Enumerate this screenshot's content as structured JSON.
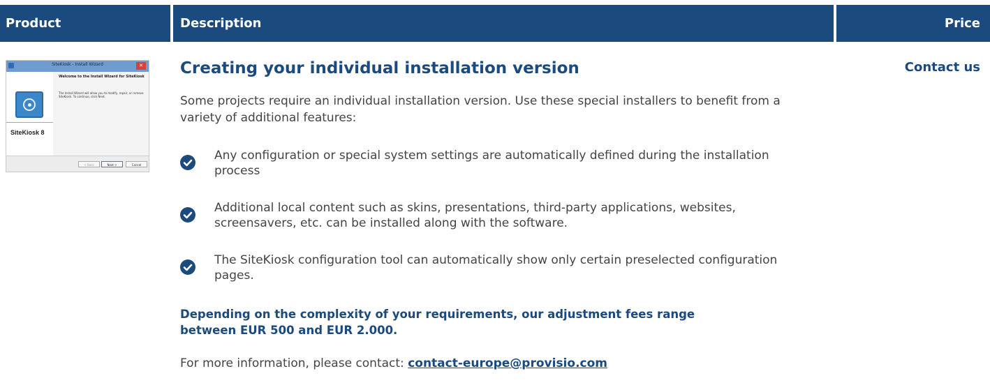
{
  "table": {
    "headers": {
      "product": "Product",
      "description": "Description",
      "price": "Price"
    }
  },
  "colors": {
    "header_bg": "#1b4a7e",
    "accent": "#1b4a7e",
    "text": "#444444"
  },
  "product_screenshot": {
    "window_title": "SiteKiosk - Install Wizard",
    "heading": "Welcome to the Install Wizard for SiteKiosk",
    "body": "The Install Wizard will allow you to modify, repair, or remove SiteKiosk. To continue, click Next.",
    "product_name": "SiteKiosk 8",
    "buttons": {
      "back": "< Back",
      "next": "Next >",
      "cancel": "Cancel"
    }
  },
  "description": {
    "title": "Creating your individual installation version",
    "intro": "Some projects require an individual installation version. Use these special installers to benefit from a variety of additional features:",
    "features": [
      {
        "icon": "check-circle-icon",
        "text": "Any configuration or special system settings are automatically defined during the installation process"
      },
      {
        "icon": "check-circle-icon",
        "text": "Additional local content such as skins, presentations, third-party applications, websites, screensavers, etc. can be installed along with the software."
      },
      {
        "icon": "check-circle-icon",
        "text": "The SiteKiosk configuration tool can automatically show only certain preselected configuration pages."
      }
    ],
    "fees_note": "Depending on the complexity of your requirements, our adjustment fees range between EUR 500 and EUR 2.000.",
    "contact_prefix": "For more information, please contact: ",
    "contact_email": "contact-europe@provisio.com"
  },
  "price": {
    "link_label": "Contact us"
  }
}
